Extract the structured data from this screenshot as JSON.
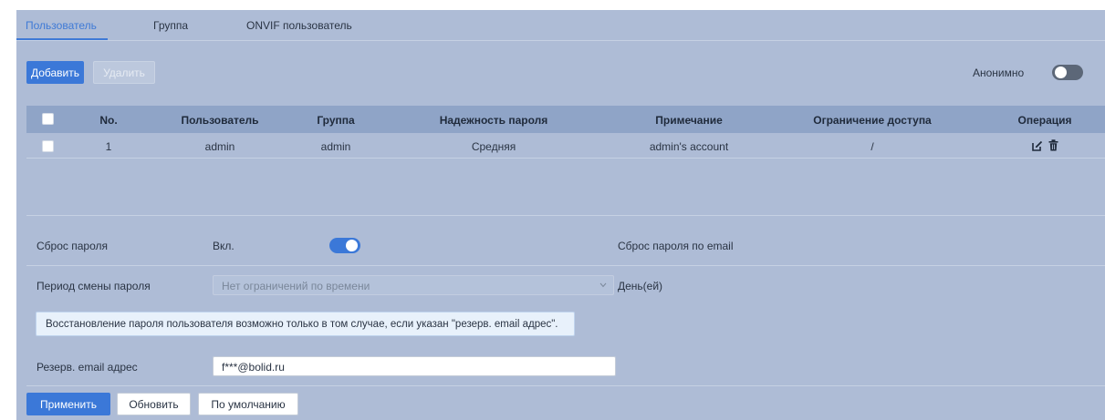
{
  "tabs": [
    "Пользователь",
    "Группа",
    "ONVIF пользователь"
  ],
  "toolbar": {
    "add_label": "Добавить",
    "delete_label": "Удалить",
    "anon_label": "Анонимно"
  },
  "table": {
    "headers": [
      "No.",
      "Пользователь",
      "Группа",
      "Надежность пароля",
      "Примечание",
      "Ограничение доступа",
      "Операция"
    ],
    "rows": [
      {
        "no": "1",
        "user": "admin",
        "group": "admin",
        "strength": "Средняя",
        "note": "admin's account",
        "access": "/"
      }
    ]
  },
  "settings": {
    "reset_label": "Сброс пароля",
    "reset_state": "Вкл.",
    "email_reset_label": "Сброс пароля по email",
    "period_label": "Период смены пароля",
    "period_value": "Нет ограничений по времени",
    "period_unit": "День(ей)",
    "notice": "Восстановление пароля пользователя возможно только в том случае, если указан \"резерв. email адрес\".",
    "email_label": "Резерв. email адрес",
    "email_value": "f***@bolid.ru"
  },
  "footer": {
    "apply_label": "Применить",
    "refresh_label": "Обновить",
    "default_label": "По умолчанию"
  },
  "colors": {
    "panel_bg": "#aebcd6",
    "accent": "#3b78d8",
    "table_header_bg": "#8fa4c7"
  },
  "toggles": {
    "anonymous": false,
    "password_reset": true
  }
}
